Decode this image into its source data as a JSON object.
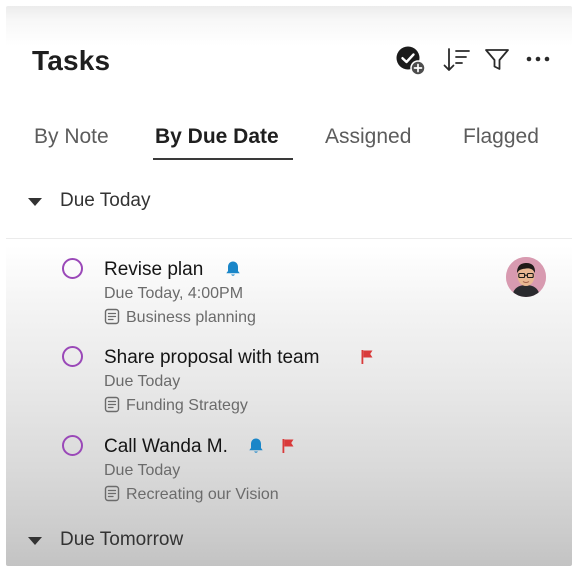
{
  "header": {
    "title": "Tasks"
  },
  "tabs": [
    {
      "label": "By Note",
      "active": false
    },
    {
      "label": "By Due Date",
      "active": true
    },
    {
      "label": "Assigned",
      "active": false
    },
    {
      "label": "Flagged",
      "active": false
    }
  ],
  "sections": [
    {
      "label": "Due Today",
      "tasks": [
        {
          "title": "Revise plan",
          "due": "Due Today, 4:00PM",
          "note": "Business planning",
          "reminder": true,
          "flagged": false,
          "assignee_avatar": true
        },
        {
          "title": "Share proposal with team",
          "due": "Due Today",
          "note": "Funding Strategy",
          "reminder": false,
          "flagged": true,
          "assignee_avatar": false
        },
        {
          "title": "Call Wanda M.",
          "due": "Due Today",
          "note": "Recreating our Vision",
          "reminder": true,
          "flagged": true,
          "assignee_avatar": false
        }
      ]
    },
    {
      "label": "Due Tomorrow",
      "tasks": []
    }
  ],
  "colors": {
    "accent_checkbox": "#9a48b8",
    "reminder_bell": "#1a86c8",
    "flag": "#d93a3a"
  },
  "icons": [
    "add-task-icon",
    "sort-icon",
    "filter-icon",
    "more-options-icon",
    "bell-icon",
    "flag-icon",
    "note-icon",
    "caret-down-icon"
  ]
}
